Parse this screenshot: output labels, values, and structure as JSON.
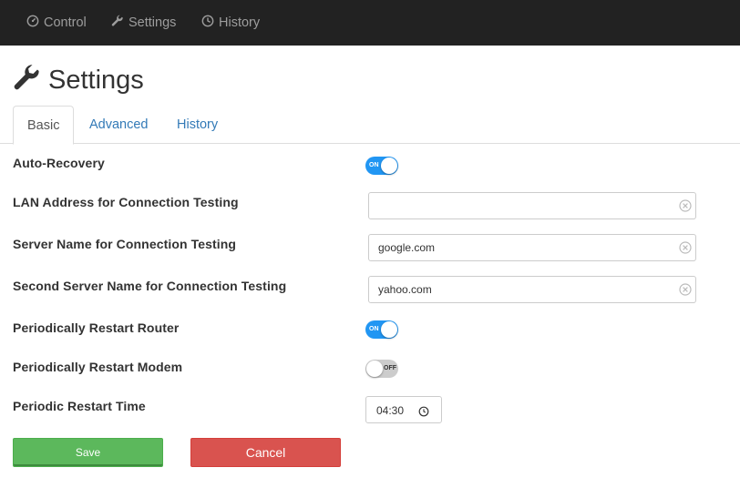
{
  "nav": {
    "items": [
      {
        "label": "Control",
        "icon": "dashboard-icon"
      },
      {
        "label": "Settings",
        "icon": "wrench-icon"
      },
      {
        "label": "History",
        "icon": "clock-icon"
      }
    ]
  },
  "page": {
    "title": "Settings",
    "title_icon": "wrench-icon"
  },
  "tabs": [
    {
      "label": "Basic",
      "active": true
    },
    {
      "label": "Advanced",
      "active": false
    },
    {
      "label": "History",
      "active": false
    }
  ],
  "form": {
    "auto_recovery": {
      "label": "Auto-Recovery",
      "state": "ON",
      "enabled": true
    },
    "lan_address": {
      "label": "LAN Address for Connection Testing",
      "value": ""
    },
    "server_name": {
      "label": "Server Name for Connection Testing",
      "value": "google.com"
    },
    "second_server_name": {
      "label": "Second Server Name for Connection Testing",
      "value": "yahoo.com"
    },
    "restart_router": {
      "label": "Periodically Restart Router",
      "state": "ON",
      "enabled": true
    },
    "restart_modem": {
      "label": "Periodically Restart Modem",
      "state": "OFF",
      "enabled": false
    },
    "restart_time": {
      "label": "Periodic Restart Time",
      "value": "04:30"
    }
  },
  "buttons": {
    "save_label": "Save",
    "cancel_label": "Cancel"
  },
  "colors": {
    "navbar_bg": "#222222",
    "nav_text": "#9d9d9d",
    "link": "#337ab7",
    "toggle_on": "#2196f3",
    "toggle_off": "#cccccc",
    "save": "#5cb85c",
    "cancel": "#d9534f"
  }
}
